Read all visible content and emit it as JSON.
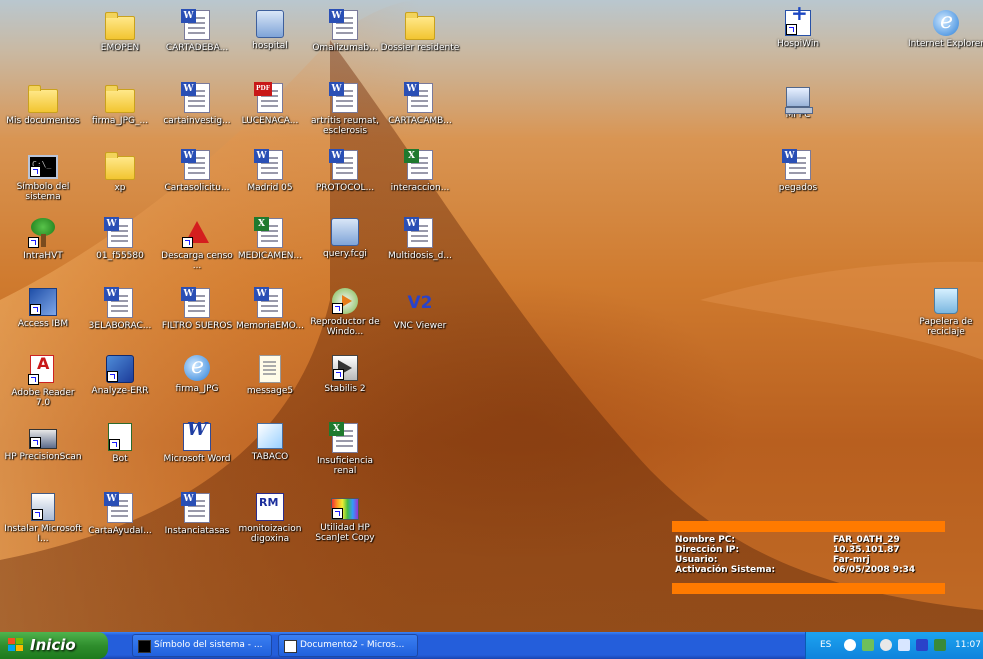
{
  "desktop": {
    "icons": [
      {
        "label": "EMOPEN",
        "icon": "folder-icon"
      },
      {
        "label": "CARTADEBA...",
        "icon": "word-document-icon"
      },
      {
        "label": "hospital",
        "icon": "network-icon"
      },
      {
        "label": "Omalizumab...",
        "icon": "word-document-icon"
      },
      {
        "label": "Dossier residente",
        "icon": "folder-icon"
      },
      {
        "label": "HospiWin",
        "icon": "hospiwin-icon"
      },
      {
        "label": "Internet Explorer",
        "icon": "internet-explorer-icon"
      },
      {
        "label": "Mis documentos",
        "icon": "my-documents-icon"
      },
      {
        "label": "firma_JPG_...",
        "icon": "folder-icon"
      },
      {
        "label": "cartainvestig...",
        "icon": "word-document-icon"
      },
      {
        "label": "LUCENACA...",
        "icon": "pdf-document-icon"
      },
      {
        "label": "artritis reumat, esclerosis",
        "icon": "word-document-icon"
      },
      {
        "label": "CARTACAMB...",
        "icon": "word-document-icon"
      },
      {
        "label": "Mi PC",
        "icon": "my-computer-icon"
      },
      {
        "label": "Símbolo del sistema",
        "icon": "command-prompt-icon"
      },
      {
        "label": "xp",
        "icon": "folder-icon"
      },
      {
        "label": "Cartasolicitu...",
        "icon": "word-document-icon"
      },
      {
        "label": "Madrid 05",
        "icon": "word-document-icon"
      },
      {
        "label": "PROTOCOL...",
        "icon": "word-document-icon"
      },
      {
        "label": "interaccion...",
        "icon": "excel-document-icon"
      },
      {
        "label": "pegados",
        "icon": "word-document-icon"
      },
      {
        "label": "IntraHVT",
        "icon": "tree-icon"
      },
      {
        "label": "01_f55580",
        "icon": "word-document-icon"
      },
      {
        "label": "Descarga censo ...",
        "icon": "download-census-icon"
      },
      {
        "label": "MEDICAMEN...",
        "icon": "excel-document-icon"
      },
      {
        "label": "query.fcgi",
        "icon": "web-file-icon"
      },
      {
        "label": "Multidosis_d...",
        "icon": "word-document-icon"
      },
      {
        "label": "Access IBM",
        "icon": "ibm-access-icon"
      },
      {
        "label": "3ELABORAC...",
        "icon": "word-document-icon"
      },
      {
        "label": "FILTRO SUEROS",
        "icon": "word-document-icon"
      },
      {
        "label": "MemoriaEMO...",
        "icon": "word-document-icon"
      },
      {
        "label": "Reproductor de Windo...",
        "icon": "media-player-icon"
      },
      {
        "label": "VNC Viewer",
        "icon": "vnc-viewer-icon"
      },
      {
        "label": "Papelera de reciclaje",
        "icon": "recycle-bin-icon"
      },
      {
        "label": "Adobe Reader 7.0",
        "icon": "adobe-reader-icon"
      },
      {
        "label": "Analyze-ERR",
        "icon": "analyze-icon"
      },
      {
        "label": "firma_JPG",
        "icon": "internet-shortcut-icon"
      },
      {
        "label": "message5",
        "icon": "text-file-icon"
      },
      {
        "label": "Stabilis 2",
        "icon": "stabilis-icon"
      },
      {
        "label": "HP PrecisionScan",
        "icon": "scanner-icon"
      },
      {
        "label": "Bot",
        "icon": "bot-file-icon"
      },
      {
        "label": "Microsoft Word",
        "icon": "microsoft-word-icon"
      },
      {
        "label": "TABACO",
        "icon": "tabaco-icon"
      },
      {
        "label": "Insuficiencia renal",
        "icon": "excel-document-icon"
      },
      {
        "label": "Instalar Microsoft I...",
        "icon": "installer-icon"
      },
      {
        "label": "CartaAyudaI...",
        "icon": "word-document-icon"
      },
      {
        "label": "Instanciatasas",
        "icon": "word-document-icon"
      },
      {
        "label": "monitoizacion digoxina",
        "icon": "monitorizacion-icon"
      },
      {
        "label": "Utilidad HP ScanJet Copy",
        "icon": "hp-scanjet-icon"
      }
    ]
  },
  "infobox": {
    "rows": [
      {
        "key": "Nombre PC:",
        "value": "FAR_0ATH_29"
      },
      {
        "key": "Dirección IP:",
        "value": "10.35.101.87"
      },
      {
        "key": "Usuario:",
        "value": "Far-mrj"
      },
      {
        "key": "Activación Sistema:",
        "value": "06/05/2008 9:34"
      }
    ],
    "accent_color": "#ff7a00"
  },
  "taskbar": {
    "start_label": "Inicio",
    "tasks": [
      {
        "label": "Símbolo del sistema - ...",
        "icon": "command-prompt-icon"
      },
      {
        "label": "Documento2 - Micros...",
        "icon": "word-document-icon"
      }
    ],
    "tray": {
      "language": "ES",
      "clock": "11:07"
    }
  },
  "colors": {
    "taskbar": "#245edb",
    "start_button": "#2f8e2d",
    "tray": "#0f83dc"
  }
}
